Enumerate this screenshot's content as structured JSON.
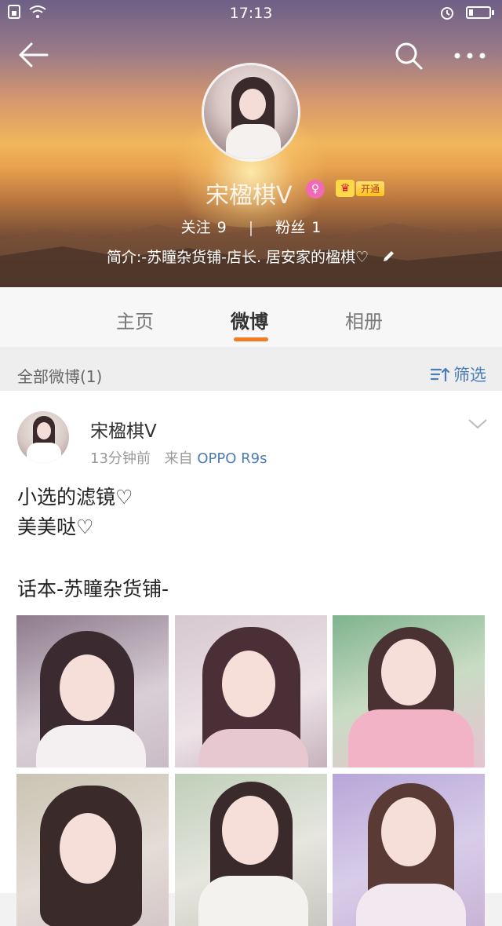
{
  "status_bar": {
    "time": "17:13"
  },
  "profile": {
    "username": "宋楹棋V",
    "vip_label": "开通",
    "following_label": "关注",
    "following_count": "9",
    "separator": "|",
    "followers_label": "粉丝",
    "followers_count": "1",
    "bio": "简介:-苏瞳杂货铺-店长. 居安家的楹棋♡"
  },
  "tabs": [
    {
      "label": "主页",
      "active": false
    },
    {
      "label": "微博",
      "active": true
    },
    {
      "label": "相册",
      "active": false
    }
  ],
  "filter_bar": {
    "count_label": "全部微博(1)",
    "filter_label": "筛选"
  },
  "post": {
    "author": "宋楹棋V",
    "time": "13分钟前",
    "source_prefix": "来自",
    "source": "OPPO R9s",
    "lines": [
      "小选的滤镜♡",
      "美美哒♡",
      "话本-苏瞳杂货铺-"
    ]
  },
  "colors": {
    "accent": "#f47b20",
    "link": "#4a7cb5"
  },
  "icons": [
    "back-arrow-icon",
    "search-icon",
    "more-icon",
    "wifi-icon",
    "alarm-icon",
    "battery-icon",
    "female-gender-icon",
    "vip-crown-icon",
    "edit-pencil-icon",
    "filter-icon",
    "chevron-down-icon"
  ]
}
